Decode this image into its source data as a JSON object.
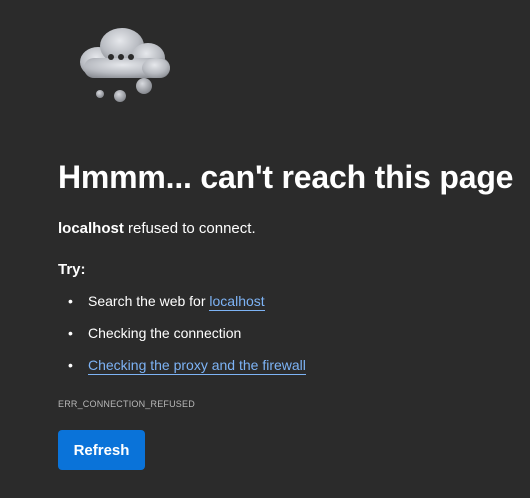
{
  "error": {
    "title": "Hmmm... can't reach this page",
    "host": "localhost",
    "message_suffix": " refused to connect.",
    "try_label": "Try:",
    "suggestions": [
      {
        "prefix": "Search the web for ",
        "link": "localhost"
      },
      {
        "text": "Checking the connection"
      },
      {
        "link": "Checking the proxy and the firewall"
      }
    ],
    "bullet": "•",
    "code": "ERR_CONNECTION_REFUSED",
    "refresh_label": "Refresh"
  },
  "icons": {
    "illustration": "thinking-cloud-icon"
  },
  "colors": {
    "background": "#2b2b2b",
    "text": "#ffffff",
    "link": "#7db3f5",
    "button": "#0a73d9",
    "muted": "#b8b8b8"
  }
}
